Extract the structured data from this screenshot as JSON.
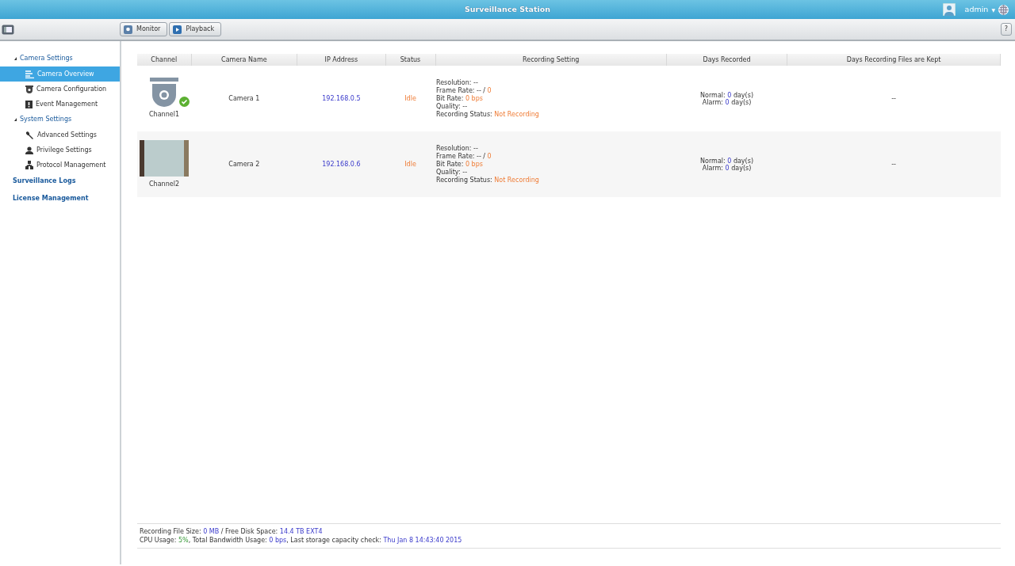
{
  "window": {
    "title": "Surveillance Station"
  },
  "user": {
    "name": "admin",
    "caret": "▼"
  },
  "toolbar": {
    "buttons": [
      {
        "label": "Monitor",
        "kind": "monitor"
      },
      {
        "label": "Playback",
        "kind": "playback"
      }
    ],
    "help": "?"
  },
  "sidebar": {
    "items": [
      {
        "label": "Camera Settings",
        "expanded": true,
        "children": [
          {
            "label": "Camera Overview",
            "kind": "list",
            "selected": true
          },
          {
            "label": "Camera Configuration",
            "kind": "camera",
            "selected": false
          },
          {
            "label": "Event Management",
            "kind": "alert",
            "selected": false
          }
        ]
      },
      {
        "label": "System Settings",
        "expanded": true,
        "children": [
          {
            "label": "Advanced Settings",
            "kind": "wrench",
            "selected": false
          },
          {
            "label": "Privilege Settings",
            "kind": "person",
            "selected": false
          },
          {
            "label": "Protocol Management",
            "kind": "network",
            "selected": false
          }
        ]
      },
      {
        "label": "Surveillance Logs"
      },
      {
        "label": "License Management"
      }
    ]
  },
  "table": {
    "columns": [
      "Channel",
      "Camera Name",
      "IP Address",
      "Status",
      "Recording Setting",
      "Days Recorded",
      "Days Recording Files are Kept"
    ],
    "rows": [
      {
        "channel": "Channel1",
        "kind": "icon",
        "connected": true,
        "name": "Camera 1",
        "ip": "192.168.0.5",
        "status": "Idle",
        "recording": [
          [
            {
              "text": "Resolution: --",
              "kind": "plain"
            }
          ],
          [
            {
              "text": "Frame Rate: -- / ",
              "kind": "plain"
            },
            {
              "text": "0",
              "kind": "warn"
            }
          ],
          [
            {
              "text": "Bit Rate: ",
              "kind": "plain"
            },
            {
              "text": "0 bps",
              "kind": "warn"
            }
          ],
          [
            {
              "text": "Quality: --",
              "kind": "plain"
            }
          ],
          [
            {
              "text": "Recording Status: ",
              "kind": "plain"
            },
            {
              "text": "Not Recording",
              "kind": "warn"
            }
          ]
        ],
        "days": [
          [
            {
              "text": "Normal: ",
              "kind": "plain"
            },
            {
              "text": "0",
              "kind": "info"
            },
            {
              "text": " day(s)",
              "kind": "plain"
            }
          ],
          [
            {
              "text": "Alarm: ",
              "kind": "plain"
            },
            {
              "text": "0",
              "kind": "info"
            },
            {
              "text": " day(s)",
              "kind": "plain"
            }
          ]
        ],
        "kept": "--"
      },
      {
        "channel": "Channel2",
        "kind": "photo",
        "connected": false,
        "name": "Camera 2",
        "ip": "192.168.0.6",
        "status": "Idle",
        "recording": [
          [
            {
              "text": "Resolution: --",
              "kind": "plain"
            }
          ],
          [
            {
              "text": "Frame Rate: -- / ",
              "kind": "plain"
            },
            {
              "text": "0",
              "kind": "warn"
            }
          ],
          [
            {
              "text": "Bit Rate: ",
              "kind": "plain"
            },
            {
              "text": "0 bps",
              "kind": "warn"
            }
          ],
          [
            {
              "text": "Quality: --",
              "kind": "plain"
            }
          ],
          [
            {
              "text": "Recording Status: ",
              "kind": "plain"
            },
            {
              "text": "Not Recording",
              "kind": "warn"
            }
          ]
        ],
        "days": [
          [
            {
              "text": "Normal: ",
              "kind": "plain"
            },
            {
              "text": "0",
              "kind": "info"
            },
            {
              "text": " day(s)",
              "kind": "plain"
            }
          ],
          [
            {
              "text": "Alarm: ",
              "kind": "plain"
            },
            {
              "text": "0",
              "kind": "info"
            },
            {
              "text": " day(s)",
              "kind": "plain"
            }
          ]
        ],
        "kept": "--"
      }
    ]
  },
  "footer": [
    [
      {
        "text": "Recording File Size: ",
        "kind": "plain"
      },
      {
        "text": "0 MB",
        "kind": "info"
      },
      {
        "text": " / Free Disk Space: ",
        "kind": "plain"
      },
      {
        "text": "14.4 TB EXT4",
        "kind": "info"
      }
    ],
    [
      {
        "text": "CPU Usage: ",
        "kind": "plain"
      },
      {
        "text": "5%",
        "kind": "ok"
      },
      {
        "text": ", Total Bandwidth Usage: ",
        "kind": "plain"
      },
      {
        "text": "0 bps",
        "kind": "info"
      },
      {
        "text": ", Last storage capacity check: ",
        "kind": "plain"
      },
      {
        "text": "Thu Jan 8 14:43:40 2015",
        "kind": "info"
      }
    ]
  ]
}
